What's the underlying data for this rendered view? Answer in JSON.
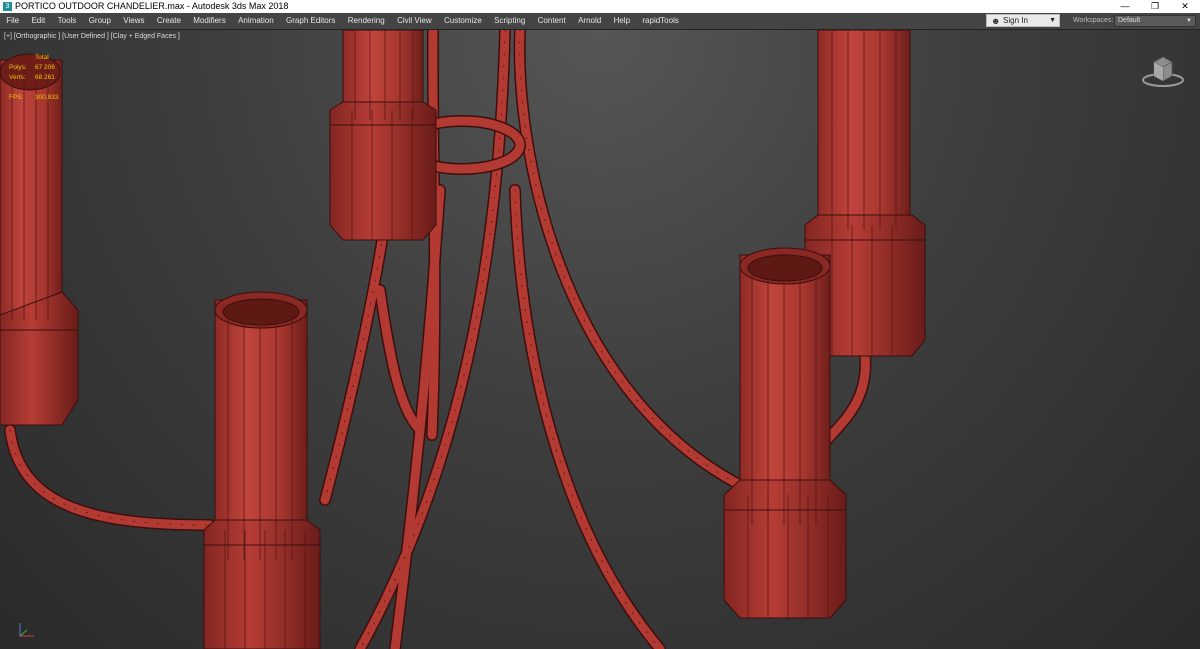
{
  "window": {
    "title": "PORTICO OUTDOOR CHANDELIER.max - Autodesk 3ds Max 2018",
    "app_icon": "3ds-max-icon",
    "controls": [
      "—",
      "❐",
      "✕"
    ]
  },
  "menubar": {
    "items": [
      "File",
      "Edit",
      "Tools",
      "Group",
      "Views",
      "Create",
      "Modifiers",
      "Animation",
      "Graph Editors",
      "Rendering",
      "Civil View",
      "Customize",
      "Scripting",
      "Content",
      "Arnold",
      "Help",
      "rapidTools"
    ],
    "sign_in": "Sign In",
    "workspaces_label": "Workspaces:",
    "workspace_value": "Default"
  },
  "viewport": {
    "label": "[+] [Orthographic ] [User Defined ] [Clay + Edged Faces ]",
    "stats": {
      "header": "Total",
      "polys_label": "Polys:",
      "polys_value": "67 206",
      "verts_label": "Verts:",
      "verts_value": "68 261",
      "fps_label": "FPS:",
      "fps_value": "300,833"
    }
  },
  "colors": {
    "clay": "#b23a32",
    "clay_dark": "#7e2320",
    "edge": "#3b0f0d",
    "stats_text": "#f2c400"
  }
}
